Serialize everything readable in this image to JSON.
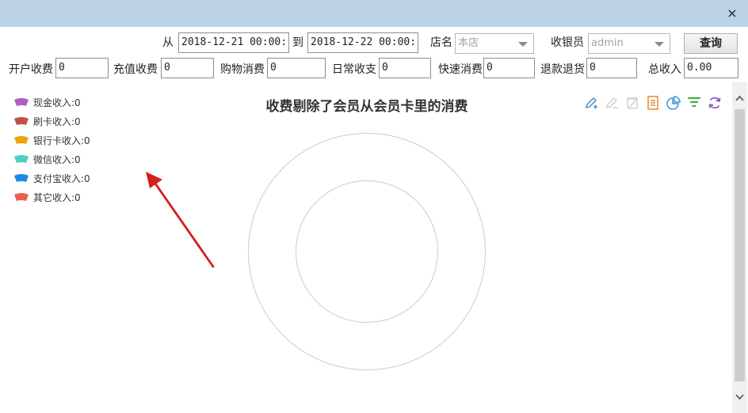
{
  "window": {
    "close_glyph": "×"
  },
  "filters": {
    "from_label": "从",
    "from_value": "2018-12-21 00:00:",
    "to_label": "到",
    "to_value": "2018-12-22 00:00:",
    "store_label": "店名",
    "store_value": "本店",
    "cashier_label": "收银员",
    "cashier_value": "admin",
    "query_label": "查询"
  },
  "stats": [
    {
      "label": "开户收费",
      "value": "0"
    },
    {
      "label": "充值收费",
      "value": "0"
    },
    {
      "label": "购物消费",
      "value": "0"
    },
    {
      "label": "日常收支",
      "value": "0"
    },
    {
      "label": "快速消费",
      "value": "0"
    },
    {
      "label": "退款退货",
      "value": "0"
    },
    {
      "label": "总收入",
      "value": "0.00"
    }
  ],
  "toolbar": {
    "icons": [
      "edit-icon",
      "erase-icon",
      "delete-icon",
      "report-icon",
      "pie-chart-icon",
      "filter-icon",
      "refresh-icon"
    ]
  },
  "chart_data": {
    "type": "pie",
    "title": "收费剔除了会员从会员卡里的消费",
    "categories": [
      "现金收入",
      "刷卡收入",
      "银行卡收入",
      "微信收入",
      "支付宝收入",
      "其它收入"
    ],
    "values": [
      0,
      0,
      0,
      0,
      0,
      0
    ],
    "legend": [
      {
        "text": "现金收入:0",
        "color": "#b05fc7"
      },
      {
        "text": "刷卡收入:0",
        "color": "#c0504d"
      },
      {
        "text": "银行卡收入:0",
        "color": "#f0a30a"
      },
      {
        "text": "微信收入:0",
        "color": "#4dd0c4"
      },
      {
        "text": "支付宝收入:0",
        "color": "#1e88e5"
      },
      {
        "text": "其它收入:0",
        "color": "#e8604c"
      }
    ],
    "legend_position": "top-left"
  }
}
